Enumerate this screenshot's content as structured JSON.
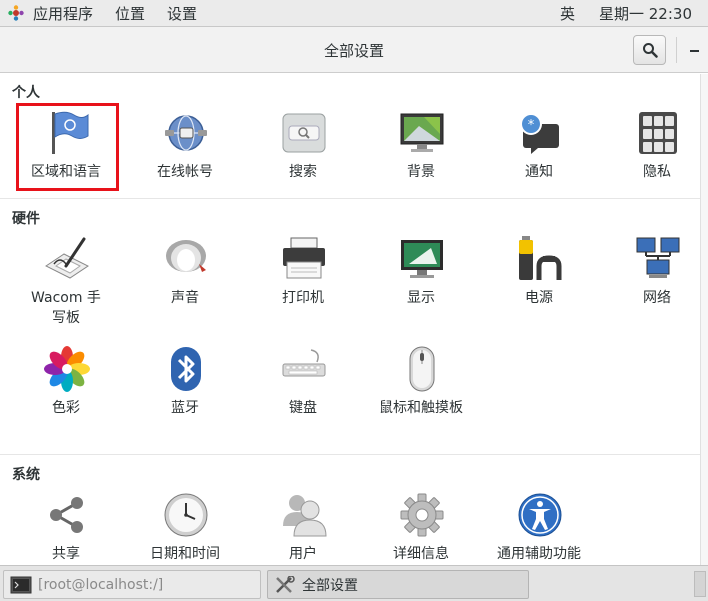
{
  "topbar": {
    "apps_menu": "应用程序",
    "places_menu": "位置",
    "settings_menu": "设置",
    "input_method": "英",
    "clock": "星期一 22:30"
  },
  "header": {
    "title": "全部设置"
  },
  "sections": {
    "personal": {
      "label": "个人",
      "items": [
        "区域和语言",
        "在线帐号",
        "搜索",
        "背景",
        "通知",
        "隐私"
      ]
    },
    "hardware": {
      "label": "硬件",
      "items": [
        "Wacom 手写板",
        "声音",
        "打印机",
        "显示",
        "电源",
        "网络",
        "色彩",
        "蓝牙",
        "键盘",
        "鼠标和触摸板"
      ]
    },
    "system": {
      "label": "系统",
      "items": [
        "共享",
        "日期和时间",
        "用户",
        "详细信息",
        "通用辅助功能"
      ]
    }
  },
  "taskbar": {
    "terminal_task": "[root@localhost:/]",
    "settings_task": "全部设置"
  },
  "colors": {
    "selection_highlight": "#e8121a",
    "panel_bg": "#ebebeb",
    "header_bg": "#f2f2f2"
  }
}
